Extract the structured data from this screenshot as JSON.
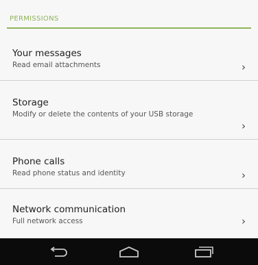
{
  "section": {
    "title": "PERMISSIONS"
  },
  "permissions": [
    {
      "title": "Your messages",
      "description": "Read email attachments",
      "chevron": "›"
    },
    {
      "title": "Storage",
      "description": "Modify or delete the contents of your USB storage",
      "chevron": "›"
    },
    {
      "title": "Phone calls",
      "description": "Read phone status and identity",
      "chevron": "›"
    },
    {
      "title": "Network communication",
      "description": "Full network access",
      "chevron": "›"
    }
  ],
  "navigation": {
    "back_icon": "back-arrow-icon",
    "home_icon": "home-icon",
    "recents_icon": "recent-apps-icon"
  },
  "colors": {
    "accent": "#8fb35a",
    "nav_background": "#0b0b0b",
    "background": "#f7f7f7"
  }
}
